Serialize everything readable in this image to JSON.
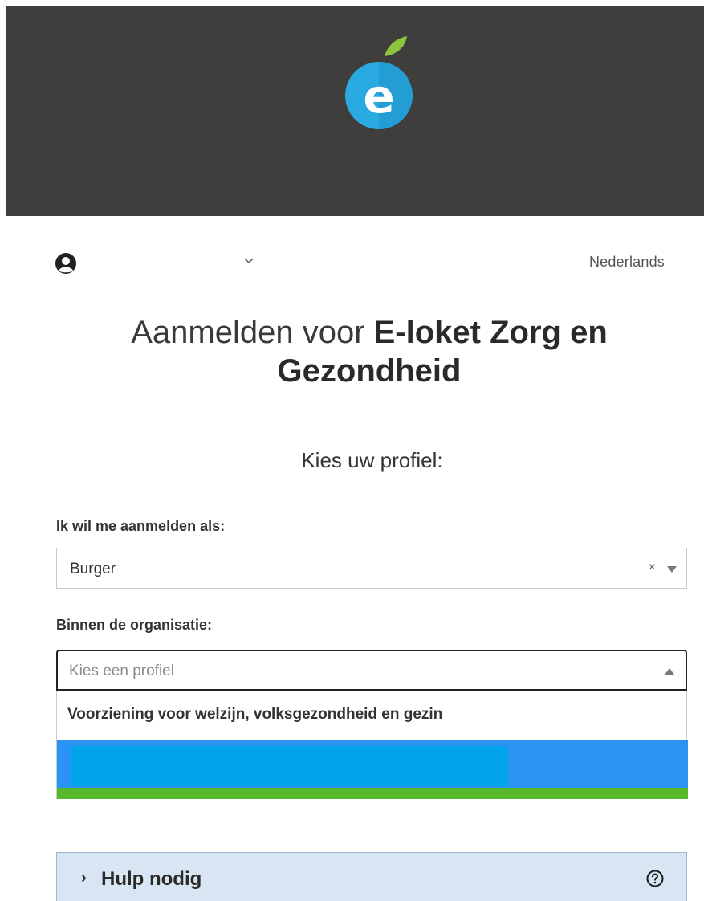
{
  "header": {
    "logo_icon": "eloket-apple-logo-icon",
    "logo_letter": "e",
    "background_color": "#403e3d"
  },
  "toolbar": {
    "user_icon": "user-circle-icon",
    "dropdown_icon": "chevron-down-icon",
    "language": "Nederlands"
  },
  "page": {
    "title_light": "Aanmelden voor ",
    "title_bold": "E-loket Zorg en Gezondheid",
    "subtitle": "Kies uw profiel:"
  },
  "form": {
    "role_label": "Ik wil me aanmelden als:",
    "role_value": "Burger",
    "clear_symbol": "×",
    "org_label": "Binnen de organisatie:",
    "org_placeholder": "Kies een profiel",
    "dropdown": {
      "group_header": "Voorziening voor welzijn, volksgezondheid en gezin",
      "highlight_color": "#2b93f4",
      "indicator_color": "#57b82c"
    }
  },
  "help": {
    "chevron": "›",
    "label": "Hulp nodig",
    "icon": "question-circle-icon"
  }
}
